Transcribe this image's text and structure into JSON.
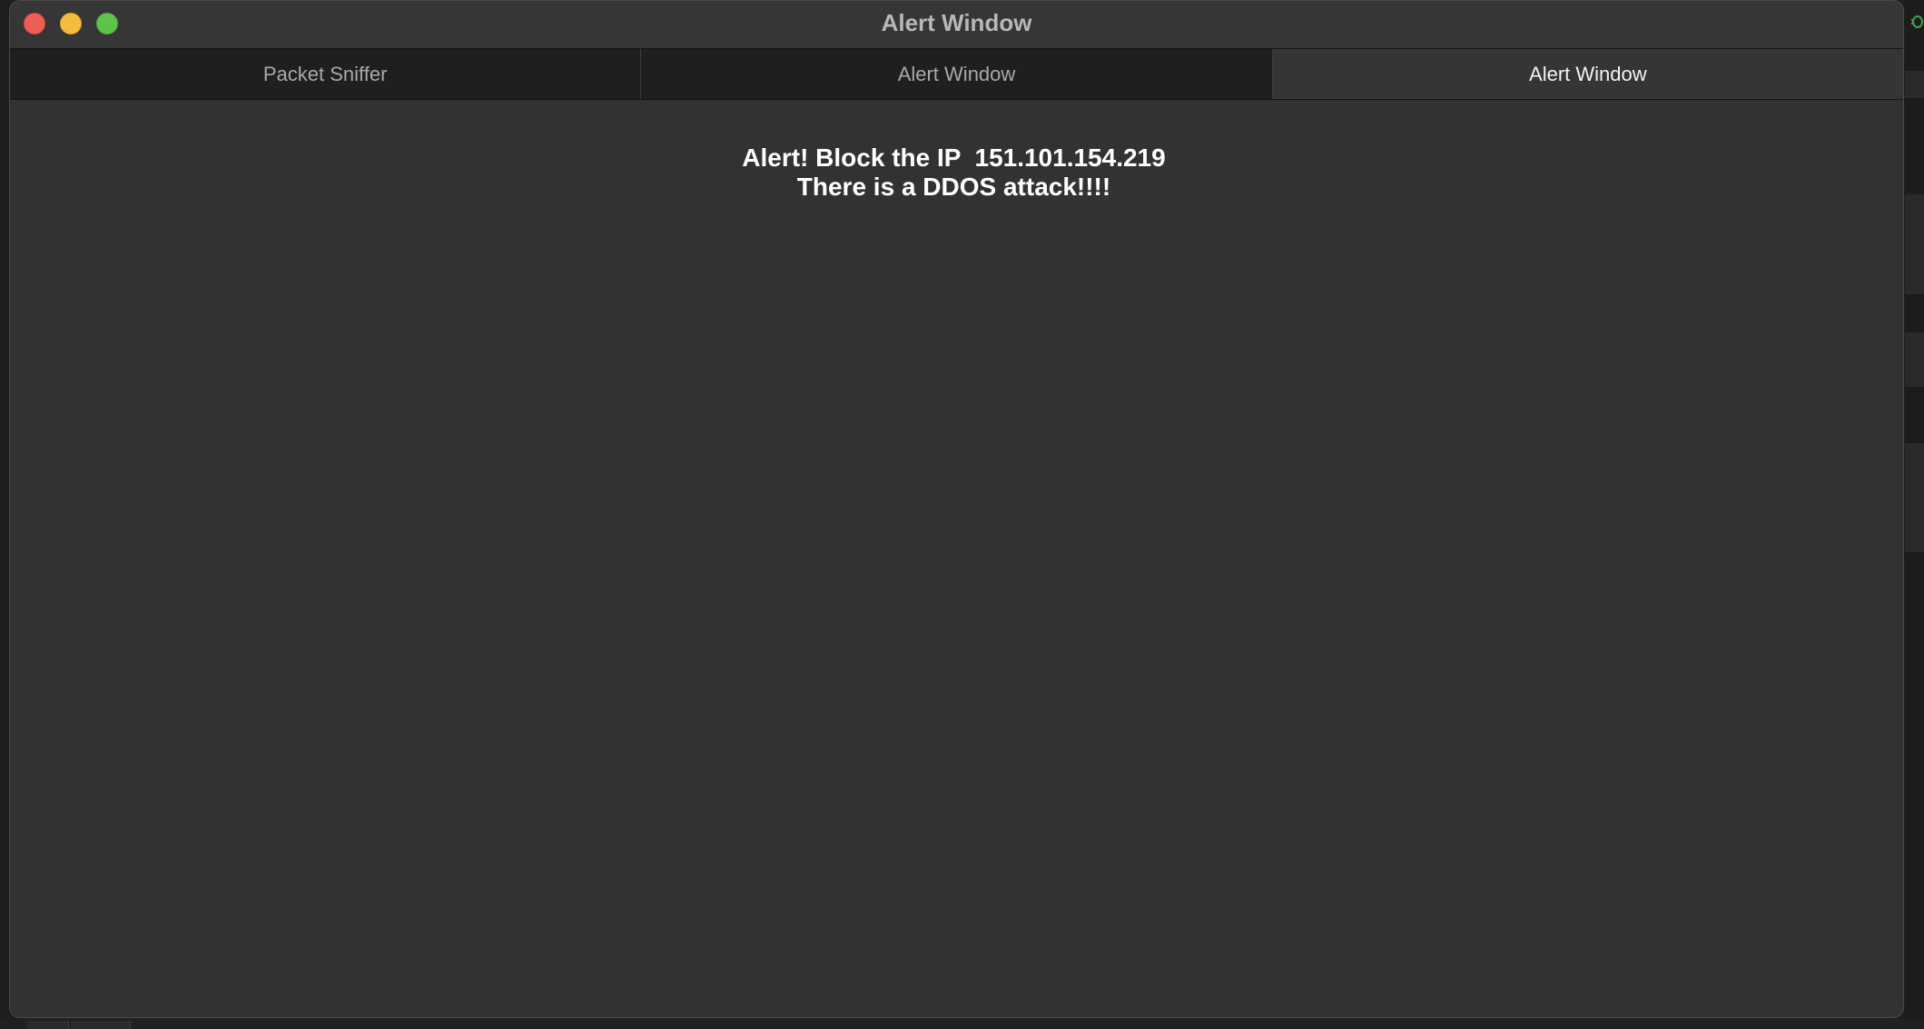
{
  "window": {
    "title": "Alert Window"
  },
  "tabs": [
    {
      "label": "Packet Sniffer",
      "active": false
    },
    {
      "label": "Alert Window",
      "active": false
    },
    {
      "label": "Alert Window",
      "active": true
    }
  ],
  "alert": {
    "line1": "Alert! Block the IP  151.101.154.219",
    "line2": "There is a DDOS attack!!!!"
  },
  "colors": {
    "close": "#ee5d56",
    "minimize": "#f4bd3f",
    "zoom": "#5fc34b",
    "background_app_icon": "#3fa34d"
  },
  "icons": {
    "background_app": "bug-icon"
  }
}
